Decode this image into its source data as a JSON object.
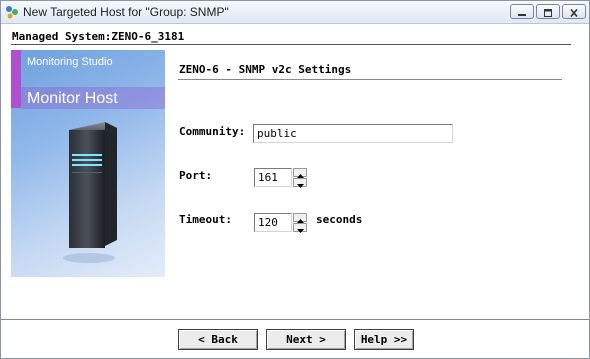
{
  "window": {
    "title": "New Targeted Host for \"Group: SNMP\"",
    "icons": {
      "app": "app-icon",
      "minimize": "minimize-icon",
      "maximize": "maximize-icon",
      "close": "close-icon"
    }
  },
  "header": {
    "managed_system": "Managed System:ZENO-6_3181"
  },
  "banner": {
    "product": "Monitoring Studio",
    "heading": "Monitor Host",
    "image": "server-tower-icon"
  },
  "settings": {
    "title": "ZENO-6 - SNMP v2c Settings",
    "community_label": "Community:",
    "community_value": "public",
    "port_label": "Port:",
    "port_value": "161",
    "timeout_label": "Timeout:",
    "timeout_value": "120",
    "timeout_unit": "seconds"
  },
  "buttons": {
    "back": "< Back",
    "next": "Next >",
    "help": "Help >>"
  },
  "colors": {
    "accent_stripe": "#b04fd0",
    "banner_top": "#6ea1de",
    "banner_bottom": "#e4edf9"
  }
}
